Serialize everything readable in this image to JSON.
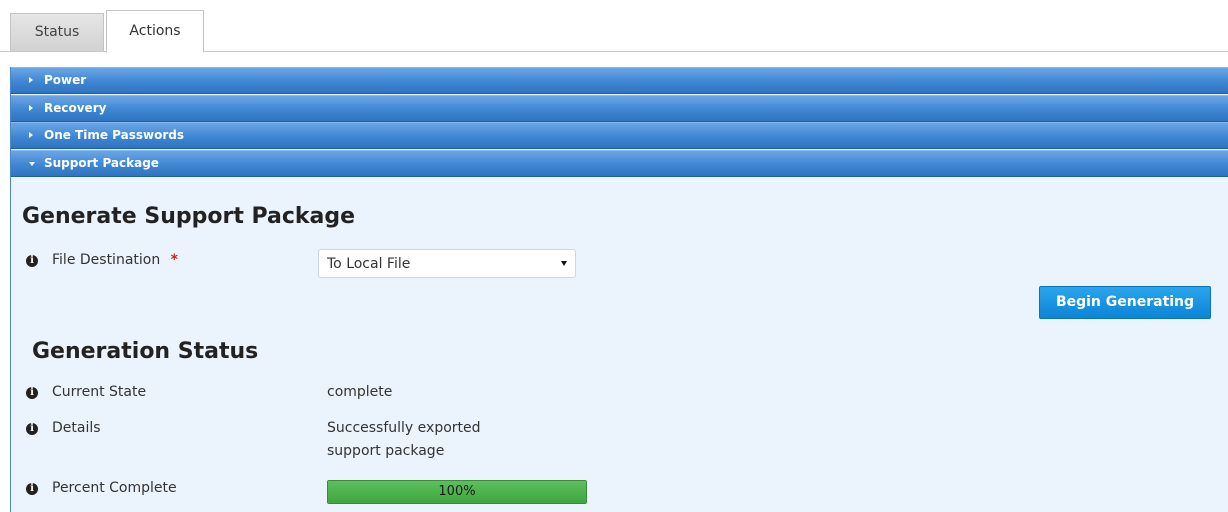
{
  "tabs": [
    {
      "label": "Status"
    },
    {
      "label": "Actions"
    }
  ],
  "accordion": [
    {
      "label": "Power",
      "expanded": false
    },
    {
      "label": "Recovery",
      "expanded": false
    },
    {
      "label": "One Time Passwords",
      "expanded": false
    },
    {
      "label": "Support Package",
      "expanded": true
    }
  ],
  "support": {
    "title": "Generate Support Package",
    "file_destination_label": "File Destination",
    "required_mark": "*",
    "file_destination_value": "To Local File",
    "begin_button": "Begin Generating"
  },
  "status": {
    "title": "Generation Status",
    "current_state_label": "Current State",
    "current_state_value": "complete",
    "details_label": "Details",
    "details_line1": "Successfully exported",
    "details_line2": "support package",
    "percent_label": "Percent Complete",
    "percent_text": "100%",
    "percent_value": 100
  },
  "colors": {
    "accordion_header": "#3f86d3",
    "panel_bg": "#ebf3fc",
    "button": "#1a95e0",
    "progress": "#4cb34c",
    "required": "#cc2222"
  },
  "icons": {
    "info": "info-circle-icon",
    "collapsed": "triangle-right-icon",
    "expanded": "triangle-down-icon",
    "dropdown": "caret-down-icon"
  }
}
